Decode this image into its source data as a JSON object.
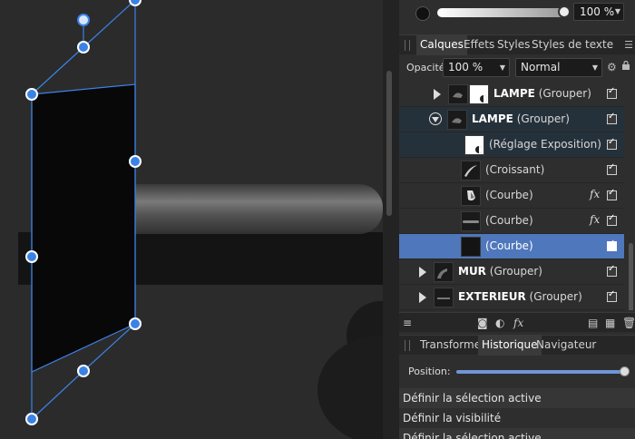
{
  "top_strip": {
    "opacity_value": "100 %"
  },
  "layers_panel": {
    "tabs": [
      {
        "label": "Calques"
      },
      {
        "label": "Effets"
      },
      {
        "label": "Styles"
      },
      {
        "label": "Styles de texte"
      }
    ],
    "opacity_label": "Opacité:",
    "opacity_value": "100 %",
    "blend_mode": "Normal",
    "layers": [
      {
        "name": "LAMPE",
        "type": "(Grouper)",
        "expanded": false,
        "visible": true
      },
      {
        "name": "LAMPE",
        "type": "(Grouper)",
        "expanded": true,
        "visible": true
      },
      {
        "name": "",
        "type": "(Réglage Exposition)",
        "visible": true
      },
      {
        "name": "",
        "type": "(Croissant)",
        "visible": true
      },
      {
        "name": "",
        "type": "(Courbe)",
        "fx": "fx",
        "visible": true
      },
      {
        "name": "",
        "type": "(Courbe)",
        "fx": "fx",
        "visible": true
      },
      {
        "name": "",
        "type": "(Courbe)",
        "selected": true,
        "visible": true
      },
      {
        "name": "MUR",
        "type": "(Grouper)",
        "expanded": false,
        "visible": true
      },
      {
        "name": "EXTERIEUR",
        "type": "(Grouper)",
        "expanded": false,
        "visible": true
      }
    ]
  },
  "bottom_panel": {
    "tabs": [
      {
        "label": "Transformer"
      },
      {
        "label": "Historique"
      },
      {
        "label": "Navigateur"
      }
    ],
    "position_label": "Position:",
    "position_value": 1.0,
    "history": [
      "Définir la sélection active",
      "Définir la visibilité",
      "Définir la sélection active"
    ]
  },
  "colors": {
    "accent": "#4f77bb",
    "selection_handle": "#3b82e6",
    "panel_bg": "#2e2e2e",
    "canvas_bg": "#2b2b2b"
  }
}
